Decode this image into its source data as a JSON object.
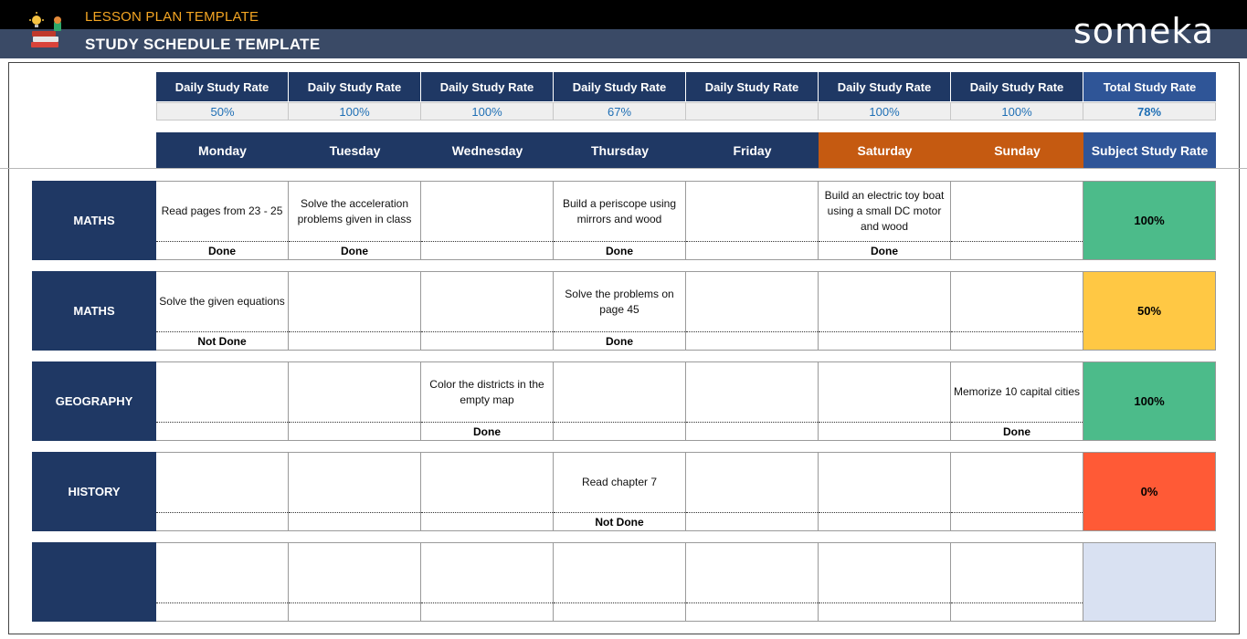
{
  "header": {
    "subtitle": "LESSON PLAN TEMPLATE",
    "title": "STUDY SCHEDULE TEMPLATE",
    "brand": "someka",
    "logo_icon": "books-lightbulb-icon"
  },
  "colors": {
    "navy": "#1f3864",
    "blue": "#2f5597",
    "weekend": "#c55a11",
    "green": "#4cbb8a",
    "yellow": "#ffc844",
    "red": "#ff5a36",
    "lavender": "#d9e1f2"
  },
  "daily_rates": {
    "labels": [
      "Daily Study Rate",
      "Daily Study Rate",
      "Daily Study Rate",
      "Daily Study Rate",
      "Daily Study Rate",
      "Daily Study Rate",
      "Daily Study Rate"
    ],
    "values": [
      "50%",
      "100%",
      "100%",
      "67%",
      "",
      "100%",
      "100%"
    ],
    "total_label": "Total Study Rate",
    "total_value": "78%"
  },
  "days": [
    "Monday",
    "Tuesday",
    "Wednesday",
    "Thursday",
    "Friday",
    "Saturday",
    "Sunday"
  ],
  "subject_rate_label": "Subject Study Rate",
  "subjects": [
    {
      "name": "MATHS",
      "rate": "100%",
      "rate_color": "#4cbb8a",
      "cells": [
        {
          "task": "Read pages from 23 - 25",
          "status": "Done"
        },
        {
          "task": "Solve the acceleration problems given in class",
          "status": "Done"
        },
        {
          "task": "",
          "status": ""
        },
        {
          "task": "Build a periscope using mirrors and wood",
          "status": "Done"
        },
        {
          "task": "",
          "status": ""
        },
        {
          "task": "Build an electric toy boat using a small DC motor and wood",
          "status": "Done"
        },
        {
          "task": "",
          "status": ""
        }
      ]
    },
    {
      "name": "MATHS",
      "rate": "50%",
      "rate_color": "#ffc844",
      "cells": [
        {
          "task": "Solve the given equations",
          "status": "Not Done"
        },
        {
          "task": "",
          "status": ""
        },
        {
          "task": "",
          "status": ""
        },
        {
          "task": "Solve the problems on page 45",
          "status": "Done"
        },
        {
          "task": "",
          "status": ""
        },
        {
          "task": "",
          "status": ""
        },
        {
          "task": "",
          "status": ""
        }
      ]
    },
    {
      "name": "GEOGRAPHY",
      "rate": "100%",
      "rate_color": "#4cbb8a",
      "cells": [
        {
          "task": "",
          "status": ""
        },
        {
          "task": "",
          "status": ""
        },
        {
          "task": "Color the districts in the empty map",
          "status": "Done"
        },
        {
          "task": "",
          "status": ""
        },
        {
          "task": "",
          "status": ""
        },
        {
          "task": "",
          "status": ""
        },
        {
          "task": "Memorize 10 capital cities",
          "status": "Done"
        }
      ]
    },
    {
      "name": "HISTORY",
      "rate": "0%",
      "rate_color": "#ff5a36",
      "cells": [
        {
          "task": "",
          "status": ""
        },
        {
          "task": "",
          "status": ""
        },
        {
          "task": "",
          "status": ""
        },
        {
          "task": "Read chapter 7",
          "status": "Not Done"
        },
        {
          "task": "",
          "status": ""
        },
        {
          "task": "",
          "status": ""
        },
        {
          "task": "",
          "status": ""
        }
      ]
    },
    {
      "name": "",
      "rate": "",
      "rate_color": "#d9e1f2",
      "cells": [
        {
          "task": "",
          "status": ""
        },
        {
          "task": "",
          "status": ""
        },
        {
          "task": "",
          "status": ""
        },
        {
          "task": "",
          "status": ""
        },
        {
          "task": "",
          "status": ""
        },
        {
          "task": "",
          "status": ""
        },
        {
          "task": "",
          "status": ""
        }
      ]
    }
  ]
}
